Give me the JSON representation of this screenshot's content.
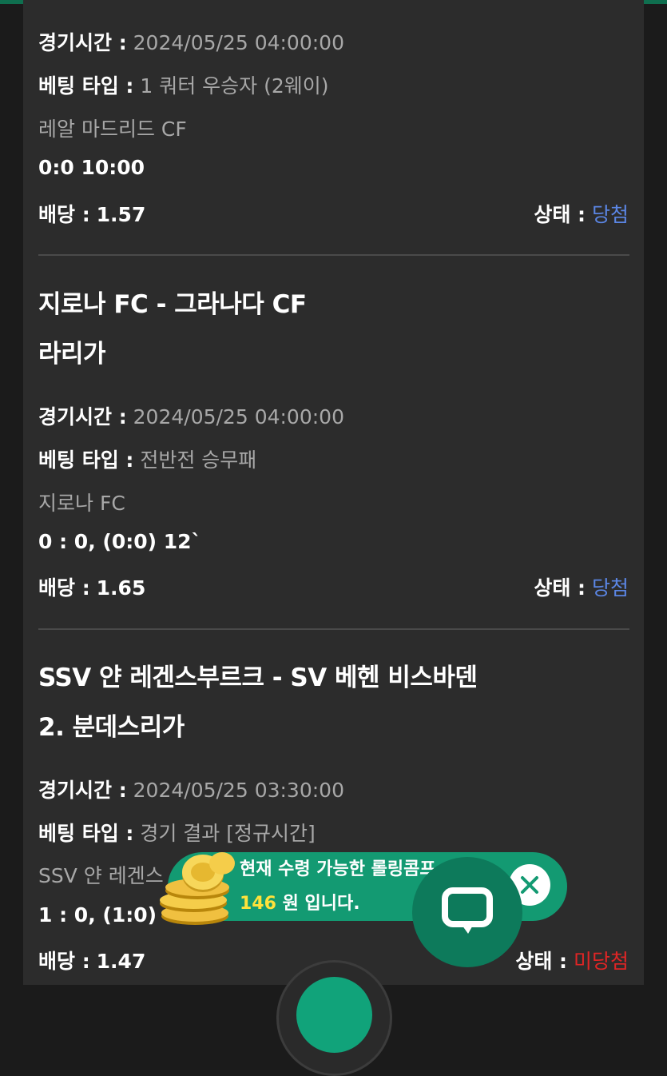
{
  "bets": [
    {
      "time_label": "경기시간 :",
      "time_value": "2024/05/25 04:00:00",
      "type_label": "베팅 타입 :",
      "type_value": "1 쿼터 우승자 (2웨이)",
      "pick": "레알 마드리드 CF",
      "score": "0:0 10:00",
      "odds_label": "배당 :",
      "odds_value": "1.57",
      "status_label": "상태 :",
      "status_value": "당첨"
    },
    {
      "match": "지로나 FC - 그라나다 CF",
      "league": "라리가",
      "time_label": "경기시간 :",
      "time_value": "2024/05/25 04:00:00",
      "type_label": "베팅 타입 :",
      "type_value": "전반전 승무패",
      "pick": "지로나 FC",
      "score": "0 : 0, (0:0) 12`",
      "odds_label": "배당 :",
      "odds_value": "1.65",
      "status_label": "상태 :",
      "status_value": "당첨"
    },
    {
      "match": "SSV 얀 레겐스부르크 - SV 베헨 비스바덴",
      "league": "2. 분데스리가",
      "time_label": "경기시간 :",
      "time_value": "2024/05/25 03:30:00",
      "type_label": "베팅 타입 :",
      "type_value": "경기 결과 [정규시간]",
      "pick": "SSV 얀 레겐스",
      "score": "1 : 0, (1:0) 43",
      "odds_label": "배당 :",
      "odds_value": "1.47",
      "status_label": "상태 :",
      "status_value": "미당첨"
    }
  ],
  "promo": {
    "line1": "현재 수령 가능한 롤링콤프",
    "amount": "146",
    "line2_suffix": "원 입니다."
  },
  "icons": {
    "coins": "gold-coins-icon",
    "close": "close-icon",
    "chat": "chat-bubble-icon"
  },
  "colors": {
    "win": "#5b86e5",
    "lose": "#e02525",
    "accent": "#139a72"
  }
}
